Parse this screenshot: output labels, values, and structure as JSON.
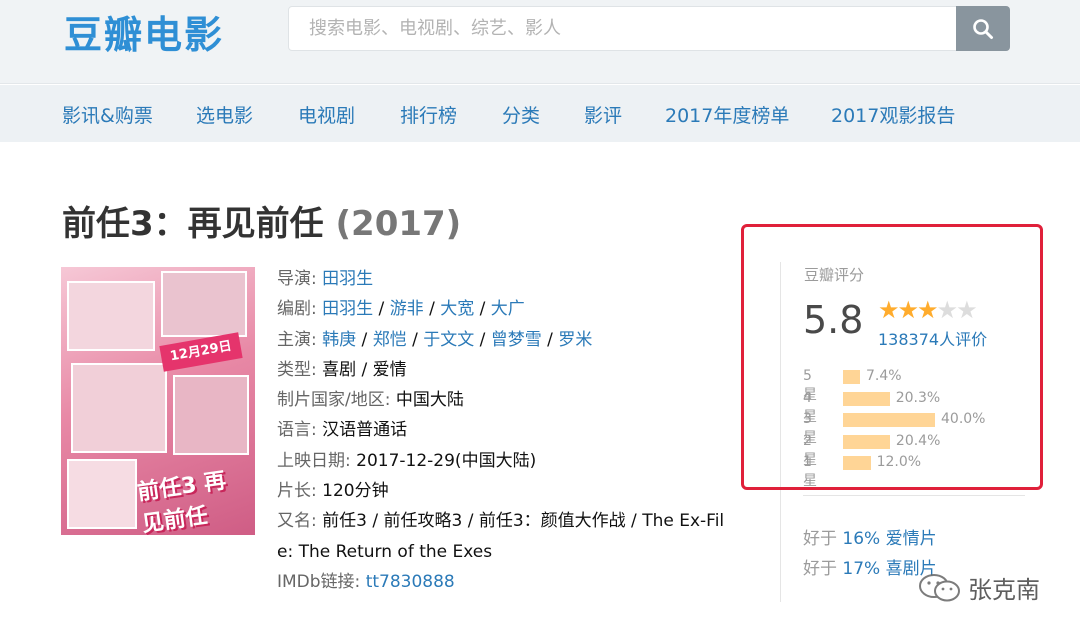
{
  "header": {
    "logo": "豆瓣电影",
    "search_placeholder": "搜索电影、电视剧、综艺、影人",
    "search_icon": "search-icon"
  },
  "nav": [
    "影讯&购票",
    "选电影",
    "电视剧",
    "排行榜",
    "分类",
    "影评",
    "2017年度榜单",
    "2017观影报告"
  ],
  "movie": {
    "title": "前任3：再见前任",
    "year": "(2017)",
    "director_label": "导演",
    "director": "田羽生",
    "writer_label": "编剧",
    "writers": [
      "田羽生",
      "游非",
      "大宽",
      "大广"
    ],
    "cast_label": "主演",
    "cast": [
      "韩庚",
      "郑恺",
      "于文文",
      "曾梦雪",
      "罗米"
    ],
    "genre_label": "类型:",
    "genre": "喜剧 / 爱情",
    "country_label": "制片国家/地区:",
    "country": "中国大陆",
    "language_label": "语言:",
    "language": "汉语普通话",
    "release_label": "上映日期:",
    "release": "2017-12-29(中国大陆)",
    "runtime_label": "片长:",
    "runtime": "120分钟",
    "aka_label": "又名:",
    "aka_line1": "前任3 / 前任攻略3 / 前任3：颜值大作战 / The Ex-Fil",
    "aka_line2": "e: The Return of the Exes",
    "imdb_label": "IMDb链接:",
    "imdb": "tt7830888"
  },
  "poster": {
    "banner": "12月29日",
    "title": "前任3 再见前任"
  },
  "rating": {
    "label": "豆瓣评分",
    "score": "5.8",
    "stars_filled": 3,
    "stars_total": 5,
    "votes": "138374人评价",
    "distribution": [
      {
        "label": "5星",
        "percent": "7.4%",
        "value": 7.4
      },
      {
        "label": "4星",
        "percent": "20.3%",
        "value": 20.3
      },
      {
        "label": "3星",
        "percent": "40.0%",
        "value": 40.0
      },
      {
        "label": "2星",
        "percent": "20.4%",
        "value": 20.4
      },
      {
        "label": "1星",
        "percent": "12.0%",
        "value": 12.0
      }
    ],
    "better_than": [
      {
        "prefix": "好于",
        "link": "16% 爱情片"
      },
      {
        "prefix": "好于",
        "link": "17% 喜剧片"
      }
    ]
  },
  "watermark": "张克南",
  "colors": {
    "link": "#2b7ab8",
    "star": "#ffac2d",
    "bar": "#ffd596",
    "highlight": "#e0203a"
  }
}
